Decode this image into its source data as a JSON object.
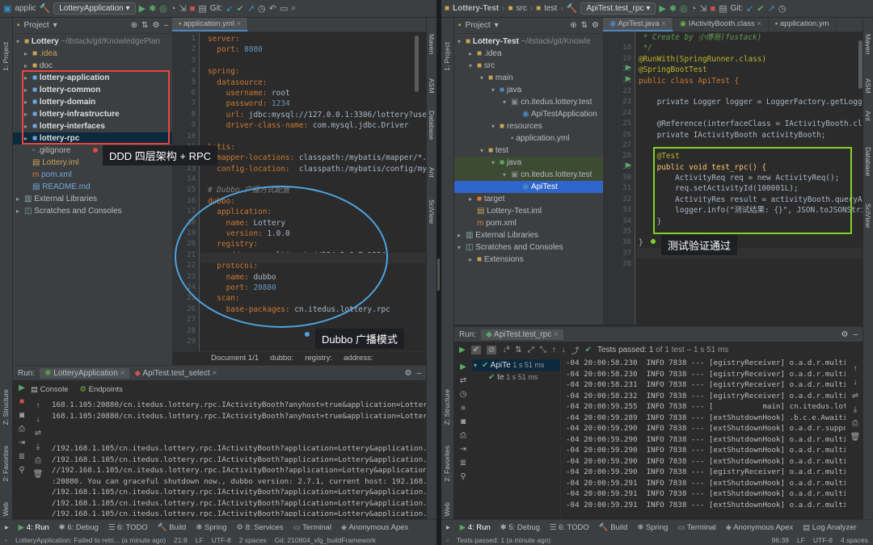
{
  "left_window": {
    "toolbar": {
      "project_name": "applic",
      "run_config": "LotteryApplication",
      "git_label": "Git:"
    },
    "left_strip": {
      "project_tab": "1: Project",
      "structure_tab": "Z: Structure",
      "favorites_tab": "2: Favorites",
      "web_tab": "Web"
    },
    "right_strip": {
      "maven": "Maven",
      "asm": "ASM",
      "database": "Database",
      "ant": "Ant",
      "sciview": "SciView"
    },
    "project_panel": {
      "title": "Project",
      "root_name": "Lottery",
      "root_path": "~/itstack/git/KnowledgePlan",
      "items": [
        {
          "label": ".idea",
          "kind": "folder",
          "arrow": "▸"
        },
        {
          "label": "doc",
          "kind": "folder",
          "arrow": "▸"
        },
        {
          "label": "lottery-application",
          "kind": "module",
          "arrow": "▸"
        },
        {
          "label": "lottery-common",
          "kind": "module",
          "arrow": "▸"
        },
        {
          "label": "lottery-domain",
          "kind": "module",
          "arrow": "▸"
        },
        {
          "label": "lottery-infrastructure",
          "kind": "module",
          "arrow": "▸"
        },
        {
          "label": "lottery-interfaces",
          "kind": "module",
          "arrow": "▸"
        },
        {
          "label": "lottery-rpc",
          "kind": "module",
          "arrow": "▸"
        },
        {
          "label": ".gitignore",
          "kind": "file",
          "arrow": ""
        },
        {
          "label": "Lottery.iml",
          "kind": "iml",
          "arrow": ""
        },
        {
          "label": "pom.xml",
          "kind": "xml",
          "arrow": ""
        },
        {
          "label": "README.md",
          "kind": "md",
          "arrow": ""
        }
      ],
      "external_libraries": "External Libraries",
      "scratches": "Scratches and Consoles"
    },
    "editor": {
      "tab": "application.yml",
      "line_numbers": [
        "1",
        "2",
        "3",
        "4",
        "5",
        "6",
        "7",
        "8",
        "9",
        "10",
        "11",
        "12",
        "13",
        "14",
        "15",
        "16",
        "17",
        "18",
        "19",
        "20",
        "21",
        "22",
        "23",
        "24",
        "25",
        "26",
        "27",
        "28",
        "29"
      ],
      "lines": [
        {
          "k": "server:",
          "v": "",
          "indent": 0,
          "type": "key"
        },
        {
          "k": "port:",
          "v": " 8080",
          "indent": 1,
          "type": "kvnum"
        },
        {
          "k": "",
          "v": "",
          "indent": 0,
          "type": "blank"
        },
        {
          "k": "spring:",
          "v": "",
          "indent": 0,
          "type": "key"
        },
        {
          "k": "datasource:",
          "v": "",
          "indent": 1,
          "type": "key"
        },
        {
          "k": "username:",
          "v": " root",
          "indent": 2,
          "type": "kv"
        },
        {
          "k": "password:",
          "v": " 1234",
          "indent": 2,
          "type": "kvnum"
        },
        {
          "k": "url:",
          "v": " jdbc:mysql://127.0.0.1:3306/lottery?useUn",
          "indent": 2,
          "type": "kv"
        },
        {
          "k": "driver-class-name:",
          "v": " com.mysql.jdbc.Driver",
          "indent": 2,
          "type": "kv"
        },
        {
          "k": "",
          "v": "",
          "indent": 0,
          "type": "blank"
        },
        {
          "k": "batis:",
          "v": "",
          "indent": 0,
          "type": "key"
        },
        {
          "k": "mapper-locations:",
          "v": " classpath:/mybatis/mapper/*.xm",
          "indent": 1,
          "type": "kv"
        },
        {
          "k": "config-location:",
          "v": "  classpath:/mybatis/config/myba",
          "indent": 1,
          "type": "kv"
        },
        {
          "k": "",
          "v": "",
          "indent": 0,
          "type": "blank"
        },
        {
          "k": "# Dubbo 广播方式配置",
          "v": "",
          "indent": 0,
          "type": "comment"
        },
        {
          "k": "dubbo:",
          "v": "",
          "indent": 0,
          "type": "key"
        },
        {
          "k": "application:",
          "v": "",
          "indent": 1,
          "type": "key"
        },
        {
          "k": "name:",
          "v": " Lottery",
          "indent": 2,
          "type": "kv"
        },
        {
          "k": "version:",
          "v": " 1.0.0",
          "indent": 2,
          "type": "kv"
        },
        {
          "k": "registry:",
          "v": "",
          "indent": 1,
          "type": "key"
        },
        {
          "k": "address:",
          "v": " multicast://224.5.6.7:1234",
          "indent": 2,
          "type": "kv"
        },
        {
          "k": "protocol:",
          "v": "",
          "indent": 1,
          "type": "key"
        },
        {
          "k": "name:",
          "v": " dubbo",
          "indent": 2,
          "type": "kv"
        },
        {
          "k": "port:",
          "v": " 20880",
          "indent": 2,
          "type": "kvnum"
        },
        {
          "k": "scan:",
          "v": "",
          "indent": 1,
          "type": "key"
        },
        {
          "k": "base-packages:",
          "v": " cn.itedus.lottery.rpc",
          "indent": 2,
          "type": "kv"
        },
        {
          "k": "",
          "v": "",
          "indent": 0,
          "type": "blank"
        },
        {
          "k": "",
          "v": "",
          "indent": 0,
          "type": "blank"
        },
        {
          "k": "",
          "v": "",
          "indent": 0,
          "type": "blank"
        }
      ],
      "breadcrumb": [
        "Document 1/1",
        "dubbo:",
        "registry:",
        "address:"
      ]
    },
    "callouts": {
      "ddd": "DDD 四层架构 + RPC",
      "dubbo": "Dubbo 广播模式"
    },
    "run_panel": {
      "label": "Run:",
      "tab1": "LotteryApplication",
      "tab2": "ApiTest.test_select",
      "console_tab": "Console",
      "endpoints_tab": "Endpoints",
      "lines": [
        "168.1.105:20880/cn.itedus.lottery.rpc.IActivityBooth?anyhost=true&application=Lottery&a",
        "168.1.105:20880/cn.itedus.lottery.rpc.IActivityBooth?anyhost=true&application=Lottery&a",
        "",
        "",
        "/192.168.1.105/cn.itedus.lottery.rpc.IActivityBooth?application=Lottery&application.ver",
        "/192.168.1.105/cn.itedus.lottery.rpc.IActivityBooth?application=Lottery&application.ver",
        "//192.168.1.105/cn.itedus.lottery.rpc.IActivityBooth?application=Lottery&application.ver",
        ":20880. You can graceful shutdown now., dubbo version: 2.7.1, current host: 192.168.1.1",
        "/192.168.1.105/cn.itedus.lottery.rpc.IActivityBooth?application=Lottery&application.ver",
        "/192.168.1.105/cn.itedus.lottery.rpc.IActivityBooth?application=Lottery&application.ver",
        "/192.168.1.105/cn.itedus.lottery.rpc.IActivityBooth?application=Lottery&application.ver"
      ]
    },
    "bottom_tabs": [
      "4: Run",
      "6: Debug",
      "6: TODO",
      "Build",
      "Spring",
      "8: Services",
      "Terminal",
      "Anonymous Apex"
    ],
    "status": {
      "message": "LotteryApplication: Failed to retri... (a minute ago)",
      "position": "21:8",
      "line_sep": "LF",
      "encoding": "UTF-8",
      "indent": "2 spaces",
      "git": "Git: 210804_xfg_buildFramework"
    }
  },
  "right_window": {
    "toolbar": {
      "crumbs": [
        "Lottery-Test",
        "src",
        "test"
      ],
      "run_config": "ApiTest.test_rpc",
      "git_label": "Git:"
    },
    "left_strip": {
      "project_tab": "1: Project",
      "structure_tab": "Z: Structure",
      "favorites_tab": "2: Favorites",
      "web_tab": "Web"
    },
    "right_strip": {
      "maven": "Maven",
      "asm": "ASM",
      "ant": "Ant",
      "database": "Database",
      "sciview": "SciView"
    },
    "project_panel": {
      "title": "Project",
      "root_name": "Lottery-Test",
      "root_path": "~/itstack/git/Knowle",
      "items": [
        {
          "label": ".idea",
          "depth": 1,
          "arrow": "▸",
          "kind": "folder"
        },
        {
          "label": "src",
          "depth": 1,
          "arrow": "▾",
          "kind": "folder"
        },
        {
          "label": "main",
          "depth": 2,
          "arrow": "▾",
          "kind": "folder"
        },
        {
          "label": "java",
          "depth": 3,
          "arrow": "▾",
          "kind": "srcfolder"
        },
        {
          "label": "cn.itedus.lottery.test",
          "depth": 4,
          "arrow": "▾",
          "kind": "package"
        },
        {
          "label": "ApiTestApplication",
          "depth": 5,
          "arrow": "",
          "kind": "class"
        },
        {
          "label": "resources",
          "depth": 3,
          "arrow": "▾",
          "kind": "folder"
        },
        {
          "label": "application.yml",
          "depth": 4,
          "arrow": "",
          "kind": "yml"
        },
        {
          "label": "test",
          "depth": 2,
          "arrow": "▾",
          "kind": "folder"
        },
        {
          "label": "java",
          "depth": 3,
          "arrow": "▾",
          "kind": "testfolder"
        },
        {
          "label": "cn.itedus.lottery.test",
          "depth": 4,
          "arrow": "▾",
          "kind": "package"
        },
        {
          "label": "ApiTest",
          "depth": 5,
          "arrow": "",
          "kind": "class"
        },
        {
          "label": "target",
          "depth": 1,
          "arrow": "▸",
          "kind": "target"
        },
        {
          "label": "Lottery-Test.iml",
          "depth": 1,
          "arrow": "",
          "kind": "iml"
        },
        {
          "label": "pom.xml",
          "depth": 1,
          "arrow": "",
          "kind": "xml"
        }
      ],
      "external_libraries": "External Libraries",
      "scratches": "Scratches and Consoles",
      "extensions": "Extensions"
    },
    "editor": {
      "tabs": [
        "ApiTest.java",
        "IActivityBooth.class",
        "application.ym"
      ],
      "line_numbers": [
        "",
        "18",
        "19",
        "20",
        "21",
        "22",
        "23",
        "24",
        "25",
        "26",
        "27",
        "28",
        "29",
        "30",
        "31",
        "32",
        "33",
        "34",
        "35",
        "36",
        "37",
        "38"
      ],
      "lines": {
        "l0": " * Create by 小傅哥(fustack)",
        "l18": " */",
        "l19": "@RunWith(SpringRunner.class)",
        "l20": "@SpringBootTest",
        "l21": "public class ApiTest {",
        "l22": "",
        "l23": "    private Logger logger = LoggerFactory.getLogger(",
        "l24": "",
        "l25": "    @Reference(interfaceClass = IActivityBooth.class",
        "l26": "    private IActivityBooth activityBooth;",
        "l27": "",
        "l28": "    @Test",
        "l29": "    public void test_rpc() {",
        "l30": "        ActivityReq req = new ActivityReq();",
        "l31": "        req.setActivityId(100001L);",
        "l32": "        ActivityRes result = activityBooth.queryActi",
        "l33": "        logger.info(\"测试结果: {}\", JSON.toJSONString",
        "l34": "    }",
        "l35": "",
        "l36": "}",
        "l37": ""
      }
    },
    "callouts": {
      "test_ok": "测试验证通过"
    },
    "run_panel": {
      "label": "Run:",
      "tab": "ApiTest.test_rpc",
      "tests_passed": "Tests passed:",
      "tests_count": "1",
      "tests_of": "of 1 test – 1 s 51 ms",
      "tree_root": "ApiTe",
      "tree_root_time": "1 s 51 ms",
      "tree_child": "te",
      "tree_child_time": "1 s 51 ms",
      "lines": [
        "-04 20:00:58.230  INFO 7838 --- [egistryReceiver] o.a.d.r.multicast.",
        "-04 20:00:58.230  INFO 7838 --- [egistryReceiver] o.a.d.r.multicast.",
        "-04 20:00:58.231  INFO 7838 --- [egistryReceiver] o.a.d.r.multicast.",
        "-04 20:00:58.232  INFO 7838 --- [egistryReceiver] o.a.d.r.multicast.",
        "-04 20:00:59.255  INFO 7838 --- [           main] cn.itedus.lottery.",
        "-04 20:00:59.289  INFO 7838 --- [extShutdownHook] .b.c.e.AwaitingNon",
        "-04 20:00:59.290  INFO 7838 --- [extShutdownHook] o.a.d.r.support.Ab",
        "-04 20:00:59.290  INFO 7838 --- [extShutdownHook] o.a.d.r.multicast.",
        "-04 20:00:59.290  INFO 7838 --- [extShutdownHook] o.a.d.r.multicast.",
        "-04 20:00:59.290  INFO 7838 --- [extShutdownHook] o.a.d.r.multicast.",
        "-04 20:00:59.290  INFO 7838 --- [egistryReceiver] o.a.d.r.multicast.",
        "-04 20:00:59.291  INFO 7838 --- [extShutdownHook] o.a.d.r.multicast.",
        "-04 20:00:59.291  INFO 7838 --- [extShutdownHook] o.a.d.r.multicast.",
        "-04 20:00:59.291  INFO 7838 --- [extShutdownHook] o.a.d.r.multicast."
      ]
    },
    "bottom_tabs": [
      "4: Run",
      "5: Debug",
      "6: TODO",
      "Build",
      "Spring",
      "Terminal",
      "Anonymous Apex",
      "Log Analyzer"
    ],
    "status": {
      "message": "Tests passed: 1 (a minute ago)",
      "position": "96:38",
      "line_sep": "LF",
      "encoding": "UTF-8",
      "indent": "4 spaces"
    }
  },
  "colors": {
    "highlight_red": "#e8463f",
    "highlight_blue": "#4fa3e0",
    "highlight_green": "#7ed321",
    "selection": "#2f65ca"
  }
}
